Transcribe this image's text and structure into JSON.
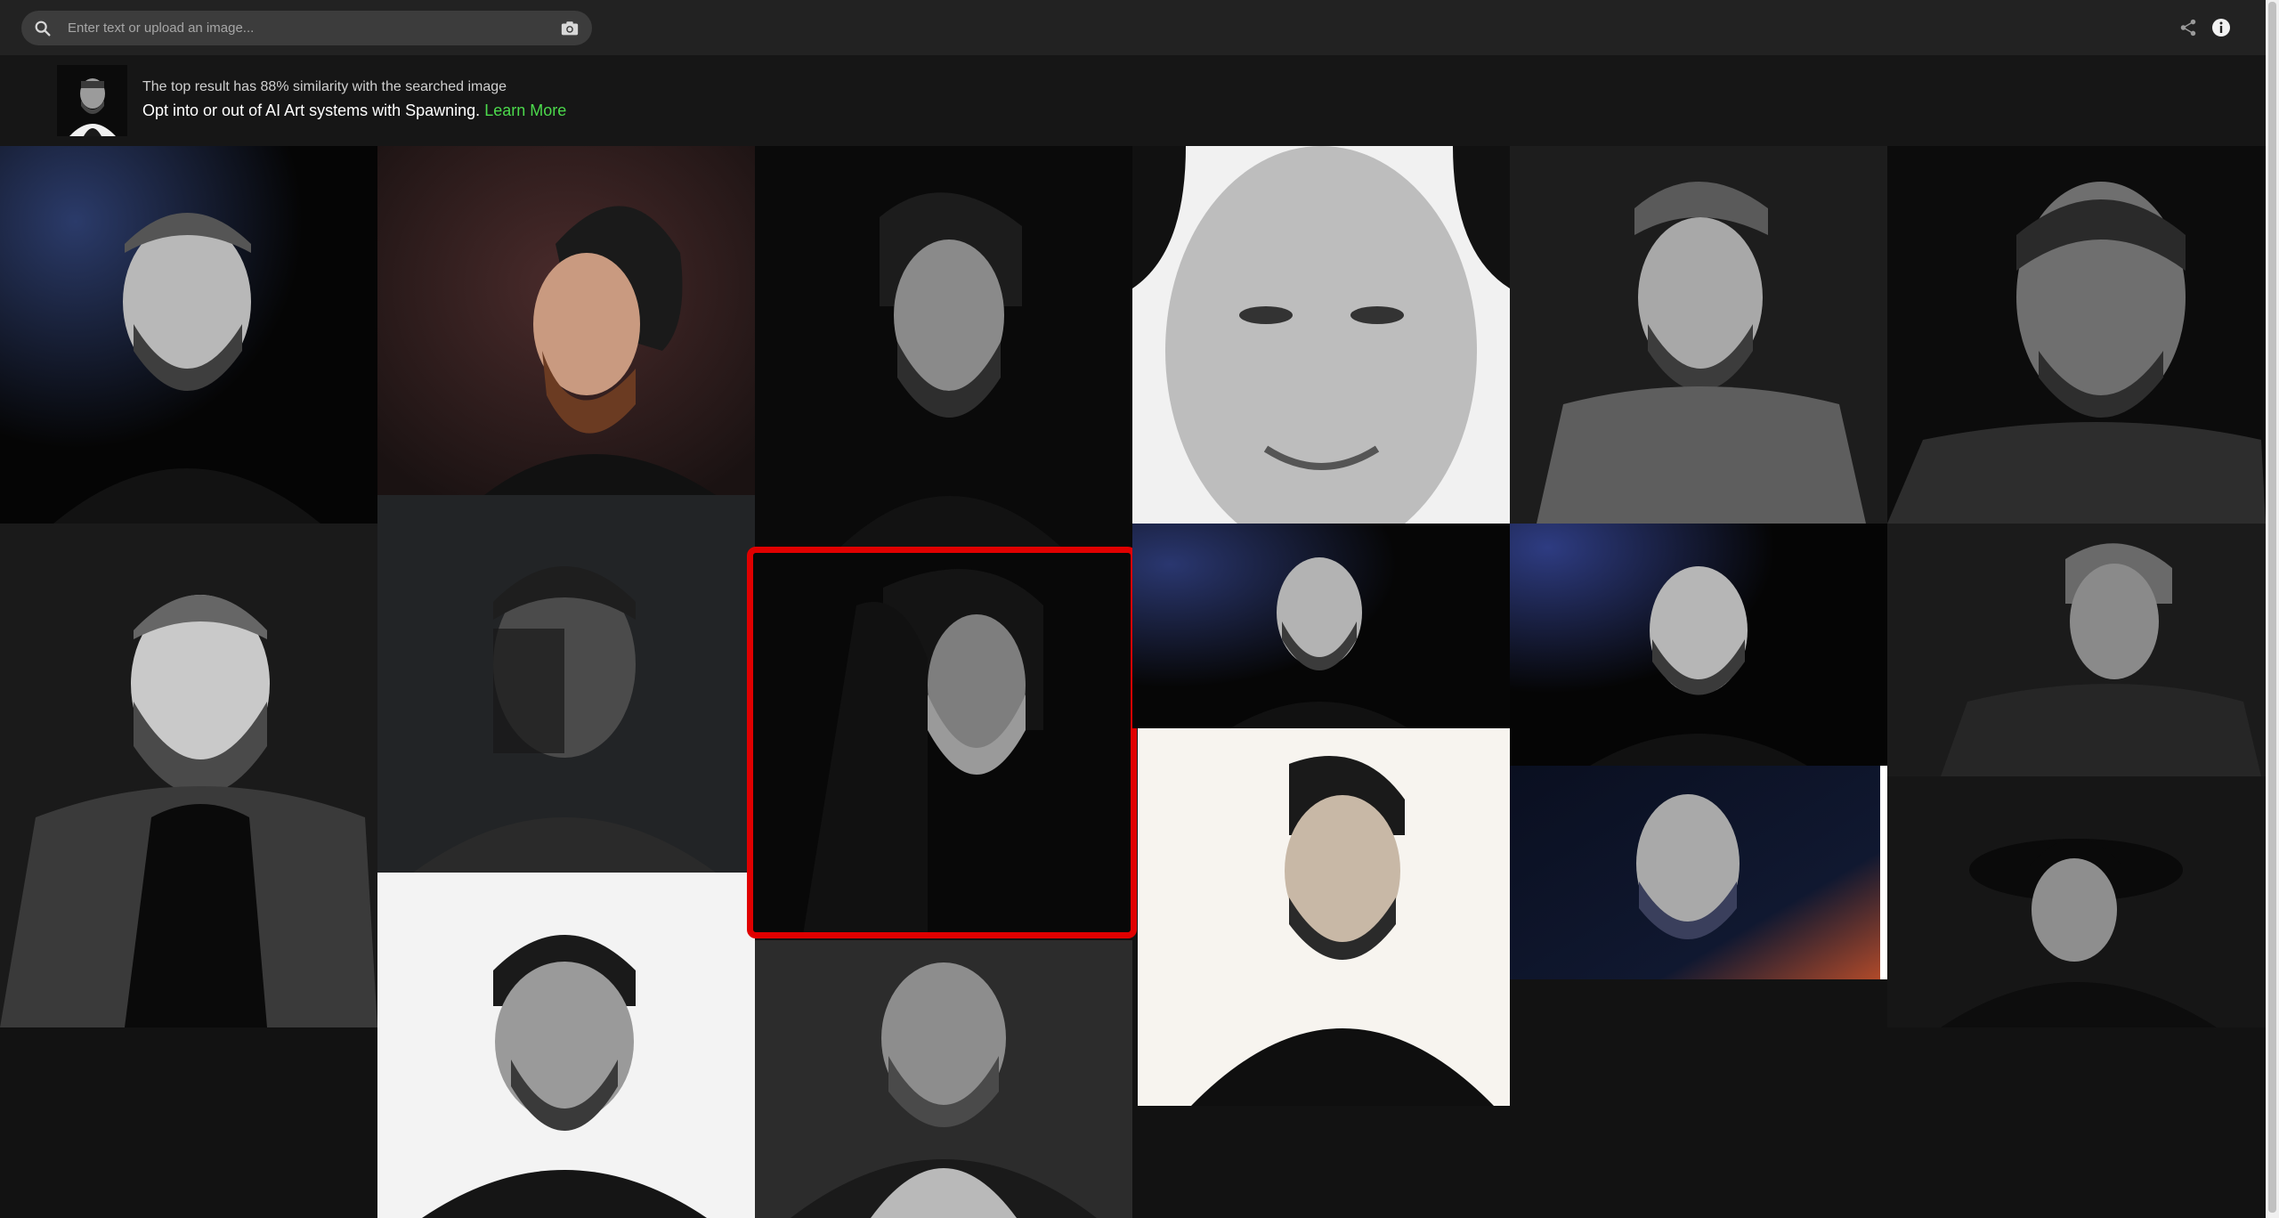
{
  "search": {
    "placeholder": "Enter text or upload an image...",
    "search_icon": "search-icon",
    "camera_icon": "camera-icon"
  },
  "toolbar": {
    "share_icon": "share-icon",
    "info_icon": "info-icon"
  },
  "banner": {
    "similarity_text": "The top result has 88% similarity with the searched image",
    "opt_text": "Opt into or out of AI Art systems with Spawning.",
    "learn_more_label": "Learn More",
    "accent_color": "#4cda4c"
  },
  "gallery": {
    "highlight_color": "#e00000",
    "results": [
      {
        "id": "result-1"
      },
      {
        "id": "result-2"
      },
      {
        "id": "result-3"
      },
      {
        "id": "result-4"
      },
      {
        "id": "result-5"
      },
      {
        "id": "result-6"
      },
      {
        "id": "result-7"
      },
      {
        "id": "result-8"
      },
      {
        "id": "result-9"
      },
      {
        "id": "result-10"
      },
      {
        "id": "result-11"
      },
      {
        "id": "result-12"
      },
      {
        "id": "result-13"
      },
      {
        "id": "result-14"
      },
      {
        "id": "result-15"
      },
      {
        "id": "result-16"
      },
      {
        "id": "result-17"
      },
      {
        "id": "result-18"
      }
    ]
  }
}
